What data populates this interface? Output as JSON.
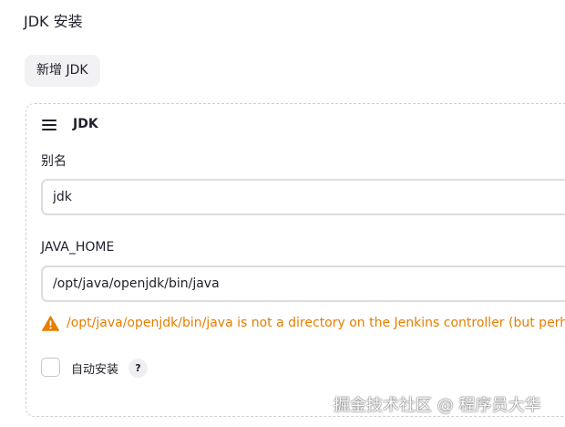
{
  "section": {
    "title": "JDK 安装"
  },
  "toolbar": {
    "add_label": "新增 JDK"
  },
  "jdk_card": {
    "title": "JDK",
    "alias_label": "别名",
    "alias_value": "jdk",
    "java_home_label": "JAVA_HOME",
    "java_home_value": "/opt/java/openjdk/bin/java",
    "warning_text": "/opt/java/openjdk/bin/java is not a directory on the Jenkins controller (but perhaps it exists on some agents)",
    "auto_install_label": "自动安装",
    "auto_install_checked": false,
    "help_label": "?"
  },
  "watermark": {
    "text": "掘金技术社区 @ 程序员大华"
  },
  "colors": {
    "warning": "#e67e00",
    "text": "#1f1f2b",
    "border": "#dcdce2",
    "button_bg": "#f2f2f5"
  },
  "icons": {
    "drag_handle": "menu-icon",
    "warning": "warning-triangle-icon"
  }
}
